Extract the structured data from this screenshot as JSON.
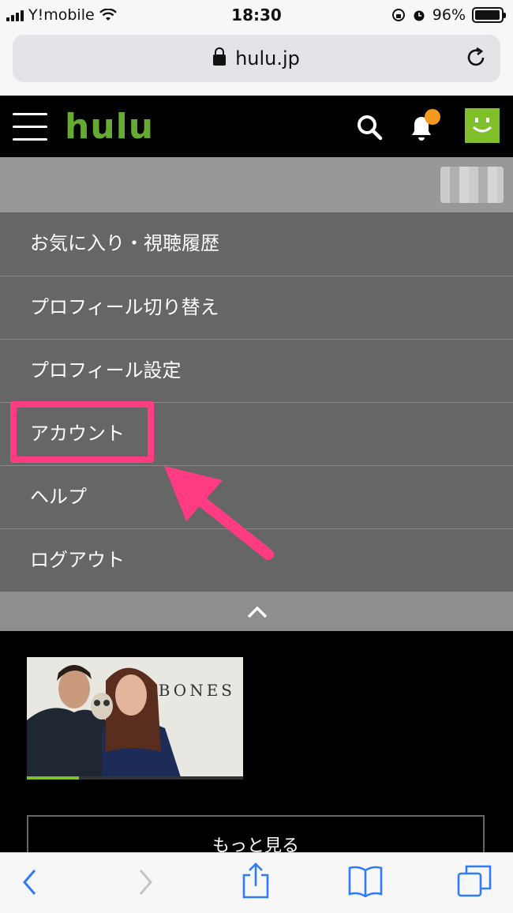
{
  "status_bar": {
    "carrier": "Y!mobile",
    "time": "18:30",
    "battery_percent": "96%",
    "battery_level": 0.96
  },
  "browser": {
    "url": "hulu.jp"
  },
  "header": {
    "logo_text": "hulu",
    "brand_color": "#66aa33",
    "notification_dot_color": "#f39a1e"
  },
  "menu": {
    "items": [
      {
        "label": "お気に入り・視聴履歴"
      },
      {
        "label": "プロフィール切り替え"
      },
      {
        "label": "プロフィール設定"
      },
      {
        "label": "アカウント"
      },
      {
        "label": "ヘルプ"
      },
      {
        "label": "ログアウト"
      }
    ],
    "highlight_color": "#ff3b82"
  },
  "content": {
    "thumbnail_title": "BONES",
    "watch_progress": 0.24,
    "more_button_label": "もっと見る"
  }
}
